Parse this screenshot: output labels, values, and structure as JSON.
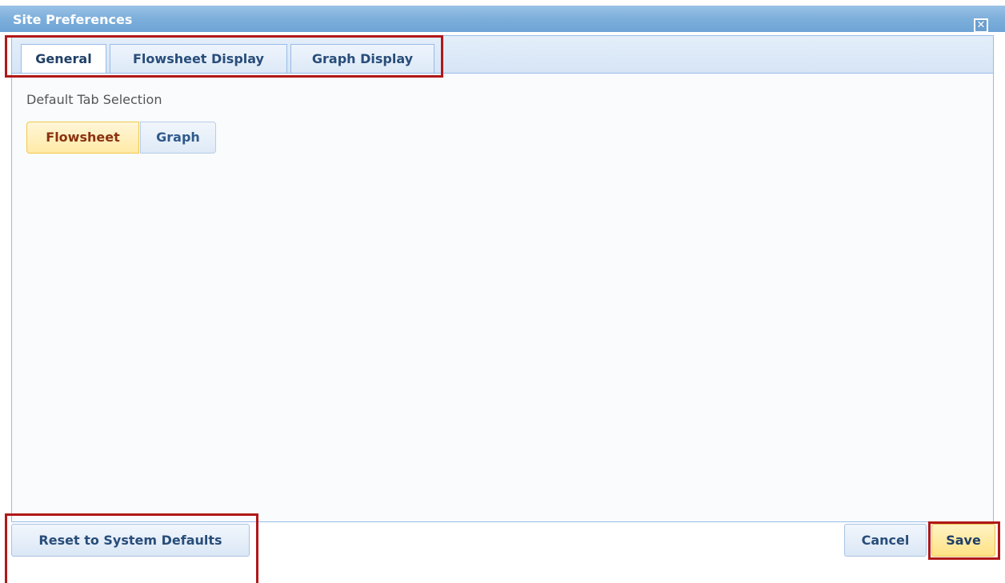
{
  "dialog": {
    "title": "Site Preferences",
    "close_label": "✕"
  },
  "tabs": [
    {
      "label": "General",
      "active": true
    },
    {
      "label": "Flowsheet Display",
      "active": false
    },
    {
      "label": "Graph Display",
      "active": false
    }
  ],
  "general": {
    "section_label": "Default Tab Selection",
    "options": [
      {
        "label": "Flowsheet",
        "selected": true
      },
      {
        "label": "Graph",
        "selected": false
      }
    ]
  },
  "footer": {
    "reset_label": "Reset to System Defaults",
    "cancel_label": "Cancel",
    "save_label": "Save"
  },
  "colors": {
    "annotation_highlight": "#b01818",
    "titlebar": "#7fb0dc",
    "selected_option": "#ffeaa6"
  }
}
